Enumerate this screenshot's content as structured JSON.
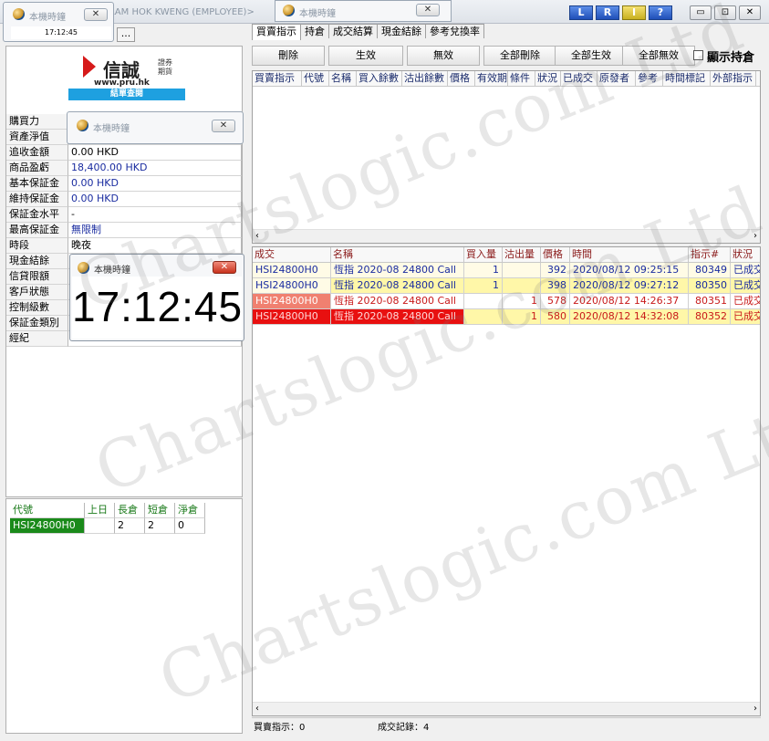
{
  "main_title": "LAM HOK KWENG (EMPLOYEE)>",
  "topbar_buttons": [
    "L",
    "R",
    "I",
    "?"
  ],
  "window_controls": [
    "▭",
    "⊡",
    "✕"
  ],
  "popup_title": "本機時鐘",
  "small_clock_time": "17:12:45",
  "small_clock_btn": "...",
  "logo_text": "信誠",
  "logo_sub1": "證券",
  "logo_sub2": "期貨",
  "logo_url": "www.pru.hk",
  "settle_btn": "結單查閱",
  "account_labels": [
    "購買力",
    "資產淨值",
    "追收金額",
    "商品盈虧",
    "基本保証金",
    "維持保証金",
    "保証金水平",
    "最高保証金",
    "時段",
    "現金結餘",
    "信貸限額",
    "客戶狀態",
    "控制級數",
    "保証金類別",
    "經紀"
  ],
  "account_values": [
    "",
    "",
    "0.00 HKD",
    "18,400.00 HKD",
    "0.00 HKD",
    "0.00 HKD",
    "-",
    "無限制",
    "晚夜",
    "",
    "",
    "",
    "",
    "",
    ""
  ],
  "big_clock_time": "17:12:45",
  "positions": {
    "headers": [
      "代號",
      "上日",
      "長倉",
      "短倉",
      "淨倉"
    ],
    "rows": [
      {
        "code": "HSI24800H0",
        "prev": "",
        "long": "2",
        "short": "2",
        "net": "0"
      }
    ]
  },
  "tabs": [
    "買賣指示",
    "持倉",
    "成交結算",
    "現金結餘",
    "參考兌換率"
  ],
  "actions": [
    "刪除",
    "生效",
    "無效",
    "全部刪除",
    "全部生效",
    "全部無效"
  ],
  "show_position_label": "顯示持倉",
  "orders_headers": [
    "買賣指示",
    "代號",
    "名稱",
    "買入餘數",
    "沽出餘數",
    "價格",
    "有效期",
    "條件",
    "狀況",
    "已成交",
    "原發者",
    "參考",
    "時間標記",
    "外部指示"
  ],
  "trades_headers": [
    "成交",
    "名稱",
    "買入量",
    "沽出量",
    "價格",
    "時間",
    "指示#",
    "狀況"
  ],
  "trades": [
    {
      "code": "HSI24800H0",
      "name": "恆指 2020-08 24800 Call",
      "buy": "1",
      "sell": "",
      "price": "392",
      "time": "2020/08/12 09:25:15",
      "ref": "80349",
      "status": "已成交"
    },
    {
      "code": "HSI24800H0",
      "name": "恆指 2020-08 24800 Call",
      "buy": "1",
      "sell": "",
      "price": "398",
      "time": "2020/08/12 09:27:12",
      "ref": "80350",
      "status": "已成交"
    },
    {
      "code": "HSI24800H0",
      "name": "恆指 2020-08 24800 Call",
      "buy": "",
      "sell": "1",
      "price": "578",
      "time": "2020/08/12 14:26:37",
      "ref": "80351",
      "status": "已成交"
    },
    {
      "code": "HSI24800H0",
      "name": "恆指 2020-08 24800 Call",
      "buy": "",
      "sell": "1",
      "price": "580",
      "time": "2020/08/12 14:32:08",
      "ref": "80352",
      "status": "已成交"
    }
  ],
  "status_bar": {
    "orders": "買賣指示：0",
    "trades": "成交記錄：4"
  },
  "watermark": "Chartslogic.com Ltd"
}
